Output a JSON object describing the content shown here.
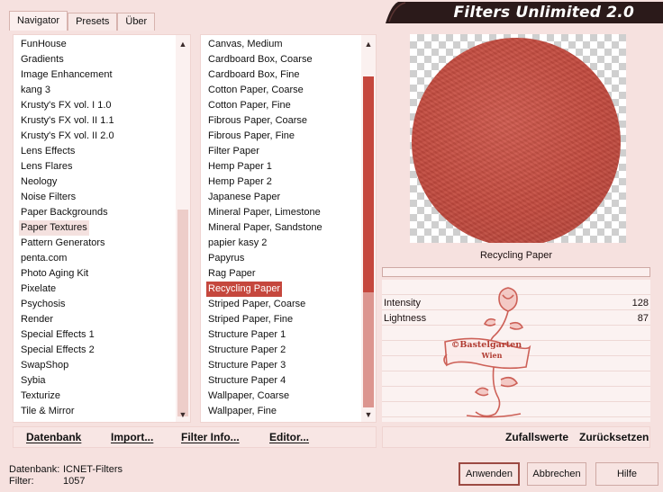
{
  "window_title": "Filters Unlimited 2.0",
  "tabs": [
    {
      "label": "Navigator",
      "active": true
    },
    {
      "label": "Presets",
      "active": false
    },
    {
      "label": "Über",
      "active": false
    }
  ],
  "categories": {
    "items": [
      "FunHouse",
      "Gradients",
      "Image Enhancement",
      "kang 3",
      "Krusty's FX vol. I 1.0",
      "Krusty's FX vol. II 1.1",
      "Krusty's FX vol. II 2.0",
      "Lens Effects",
      "Lens Flares",
      "Neology",
      "Noise Filters",
      "Paper Backgrounds",
      "Paper Textures",
      "Pattern Generators",
      "penta.com",
      "Photo Aging Kit",
      "Pixelate",
      "Psychosis",
      "Render",
      "Special Effects 1",
      "Special Effects 2",
      "SwapShop",
      "Sybia",
      "Texturize",
      "Tile & Mirror"
    ],
    "selected": "Paper Textures"
  },
  "filters": {
    "items": [
      "Canvas, Medium",
      "Cardboard Box, Coarse",
      "Cardboard Box, Fine",
      "Cotton Paper, Coarse",
      "Cotton Paper, Fine",
      "Fibrous Paper, Coarse",
      "Fibrous Paper, Fine",
      "Filter Paper",
      "Hemp Paper 1",
      "Hemp Paper 2",
      "Japanese Paper",
      "Mineral Paper, Limestone",
      "Mineral Paper, Sandstone",
      "papier kasy 2",
      "Papyrus",
      "Rag Paper",
      "Recycling Paper",
      "Striped Paper, Coarse",
      "Striped Paper, Fine",
      "Structure Paper 1",
      "Structure Paper 2",
      "Structure Paper 3",
      "Structure Paper 4",
      "Wallpaper, Coarse",
      "Wallpaper, Fine"
    ],
    "selected": "Recycling Paper"
  },
  "preview": {
    "filter_name": "Recycling Paper",
    "progress": 0
  },
  "params": [
    {
      "label": "Intensity",
      "value": "128"
    },
    {
      "label": "Lightness",
      "value": "87"
    }
  ],
  "watermark": {
    "line1": "©Bastelgarten",
    "line2": "Wien"
  },
  "bottom_left": {
    "database": "Datenbank",
    "import": "Import...",
    "filter_info": "Filter Info...",
    "editor": "Editor..."
  },
  "bottom_right": {
    "random": "Zufallswerte",
    "reset": "Zurücksetzen"
  },
  "status": {
    "database_label": "Datenbank:",
    "database_value": "ICNET-Filters",
    "filter_label": "Filter:",
    "filter_value": "1057"
  },
  "buttons": {
    "apply": "Anwenden",
    "cancel": "Abbrechen",
    "help": "Hilfe"
  },
  "colors": {
    "accent": "#c5473d",
    "window_bg": "#f6e1df",
    "banner": "#2b1a1a"
  }
}
